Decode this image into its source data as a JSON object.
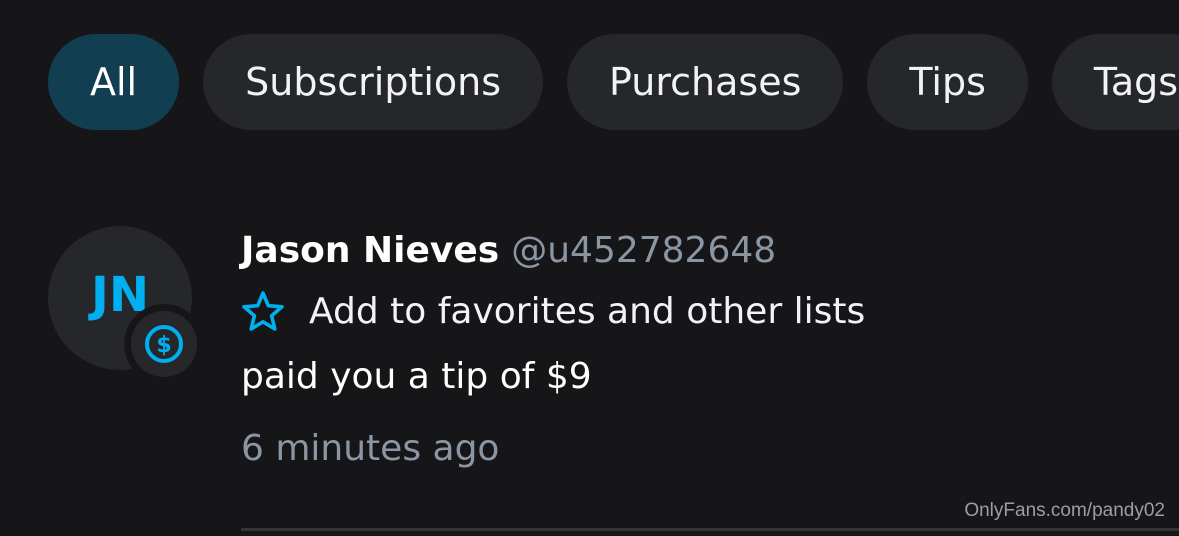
{
  "filters": {
    "items": [
      {
        "label": "All",
        "active": true
      },
      {
        "label": "Subscriptions",
        "active": false
      },
      {
        "label": "Purchases",
        "active": false
      },
      {
        "label": "Tips",
        "active": false
      },
      {
        "label": "Tags",
        "active": false
      }
    ]
  },
  "notification": {
    "avatar_initials": "JN",
    "badge_icon": "dollar-circle-icon",
    "name": "Jason Nieves",
    "handle": "@u452782648",
    "favorite_icon": "star-outline-icon",
    "favorite_label": "Add to favorites and other lists",
    "message": "paid you a tip of $9",
    "time": "6 minutes ago"
  },
  "watermark": "OnlyFans.com/pandy02",
  "colors": {
    "accent": "#00aff0",
    "background": "#161618",
    "chip": "#26272b",
    "chip_active": "#123e52",
    "muted_text": "#8a96a3"
  }
}
